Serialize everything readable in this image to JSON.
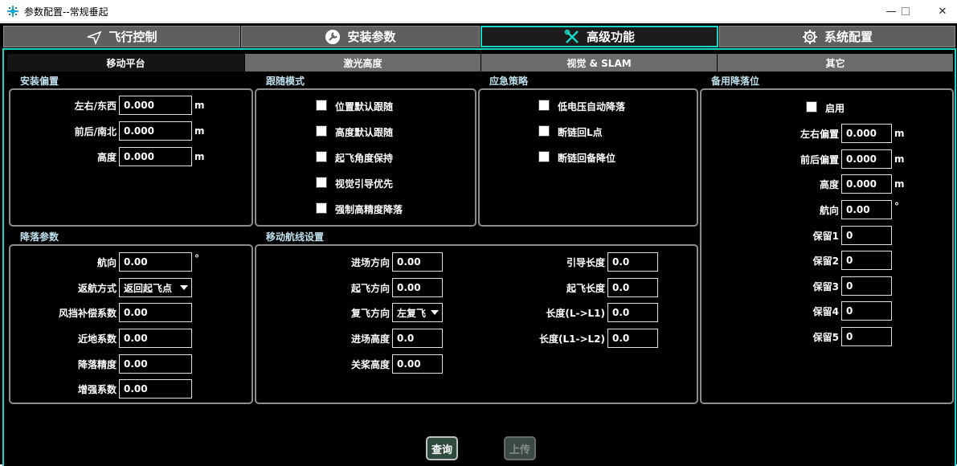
{
  "window": {
    "title": "参数配置--常规垂起",
    "minimize_icon": "minimize-icon",
    "maximize_icon": "maximize-icon",
    "close_icon": "close-icon"
  },
  "main_tabs": [
    {
      "label": "飞行控制",
      "icon": "plane-icon"
    },
    {
      "label": "安装参数",
      "icon": "wrench-circle-icon"
    },
    {
      "label": "高级功能",
      "icon": "tools-icon",
      "active": true
    },
    {
      "label": "系统配置",
      "icon": "gear-icon"
    }
  ],
  "sub_tabs": [
    {
      "label": "移动平台",
      "active": true
    },
    {
      "label": "激光高度"
    },
    {
      "label": "视觉 & SLAM"
    },
    {
      "label": "其它"
    }
  ],
  "install_offset": {
    "title": "安装偏置",
    "fields": [
      {
        "label": "左右/东西",
        "value": "0.000",
        "unit": "m"
      },
      {
        "label": "前后/南北",
        "value": "0.000",
        "unit": "m"
      },
      {
        "label": "高度",
        "value": "0.000",
        "unit": "m"
      }
    ]
  },
  "follow_mode": {
    "title": "跟随模式",
    "options": [
      {
        "label": "位置默认跟随",
        "checked": false
      },
      {
        "label": "高度默认跟随",
        "checked": false
      },
      {
        "label": "起飞角度保持",
        "checked": false
      },
      {
        "label": "视觉引导优先",
        "checked": false
      },
      {
        "label": "强制高精度降落",
        "checked": false
      }
    ]
  },
  "emergency": {
    "title": "应急策略",
    "options": [
      {
        "label": "低电压自动降落",
        "checked": false
      },
      {
        "label": "断链回L点",
        "checked": false
      },
      {
        "label": "断链回备降位",
        "checked": false
      }
    ]
  },
  "backup_landing": {
    "title": "备用降落位",
    "enable_label": "启用",
    "enabled": false,
    "fields": [
      {
        "label": "左右偏置",
        "value": "0.000",
        "unit": "m"
      },
      {
        "label": "前后偏置",
        "value": "0.000",
        "unit": "m"
      },
      {
        "label": "高度",
        "value": "0.000",
        "unit": "m"
      },
      {
        "label": "航向",
        "value": "0.00",
        "unit": "°"
      },
      {
        "label": "保留1",
        "value": "0"
      },
      {
        "label": "保留2",
        "value": "0"
      },
      {
        "label": "保留3",
        "value": "0"
      },
      {
        "label": "保留4",
        "value": "0"
      },
      {
        "label": "保留5",
        "value": "0"
      }
    ]
  },
  "landing_params": {
    "title": "降落参数",
    "fields": [
      {
        "label": "航向",
        "value": "0.00",
        "unit": "°"
      },
      {
        "label": "返航方式",
        "value": "返回起飞点",
        "type": "select"
      },
      {
        "label": "风挡补偿系数",
        "value": "0.00"
      },
      {
        "label": "近地系数",
        "value": "0.00"
      },
      {
        "label": "降落精度",
        "value": "0.00"
      },
      {
        "label": "增强系数",
        "value": "0.00"
      }
    ]
  },
  "route_settings": {
    "title": "移动航线设置",
    "left_fields": [
      {
        "label": "进场方向",
        "value": "0.00"
      },
      {
        "label": "起飞方向",
        "value": "0.00"
      },
      {
        "label": "复飞方向",
        "value": "左复飞",
        "type": "select"
      },
      {
        "label": "进场高度",
        "value": "0.0"
      },
      {
        "label": "关桨高度",
        "value": "0.00"
      }
    ],
    "right_fields": [
      {
        "label": "引导长度",
        "value": "0.0"
      },
      {
        "label": "起飞长度",
        "value": "0.0"
      },
      {
        "label": "长度(L->L1)",
        "value": "0.0"
      },
      {
        "label": "长度(L1->L2)",
        "value": "0.0"
      }
    ]
  },
  "actions": {
    "query_label": "查询",
    "upload_label": "上传",
    "upload_enabled": false
  }
}
